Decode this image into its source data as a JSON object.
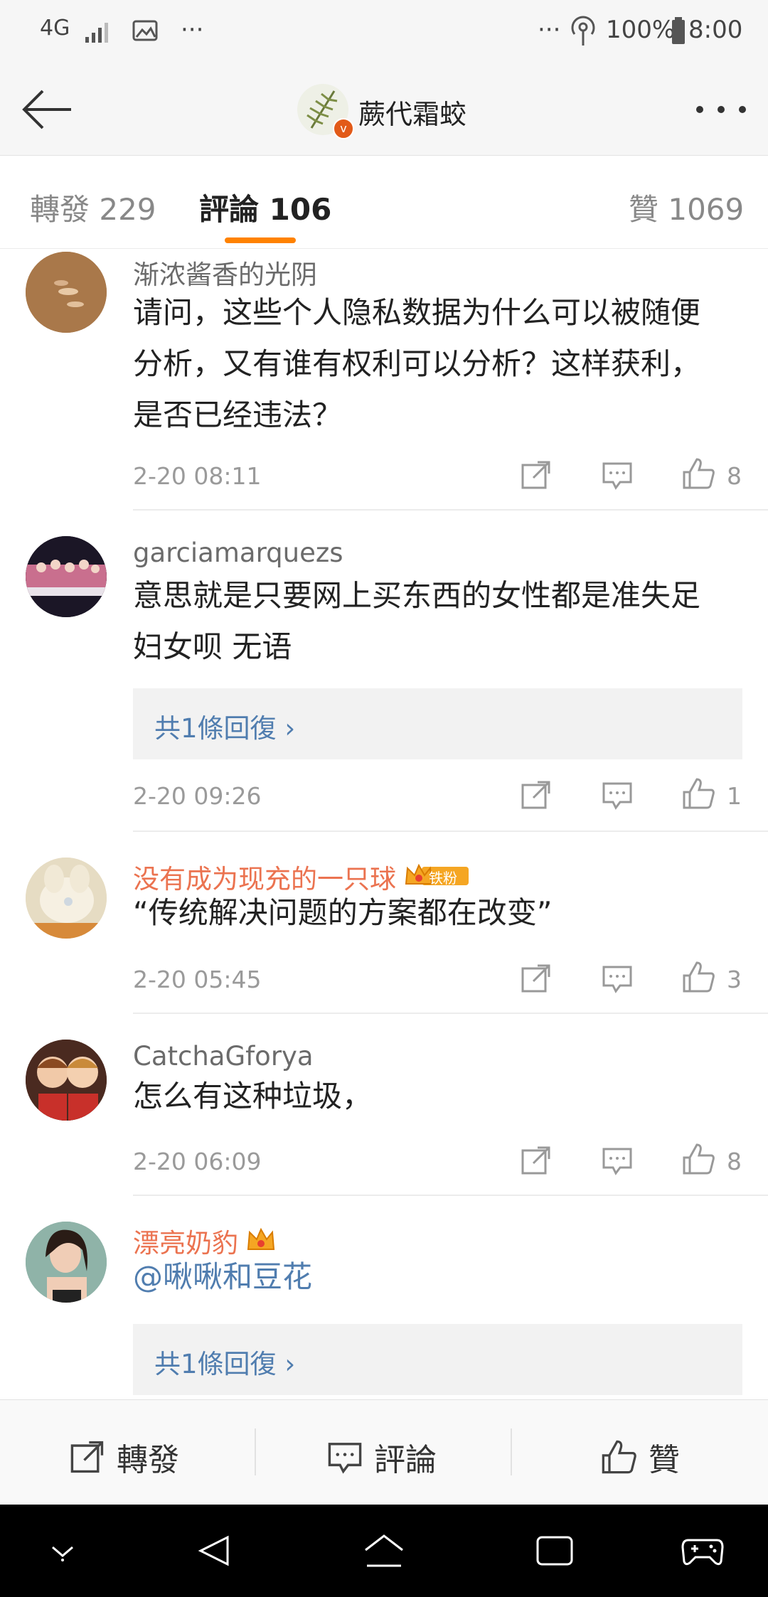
{
  "status_bar": {
    "network": "4G",
    "more_left": "···",
    "more_right": "···",
    "battery": "100%",
    "time": "8:00"
  },
  "header": {
    "title": "蕨代霜蛟"
  },
  "tabs": [
    {
      "label": "轉發 229"
    },
    {
      "label": "評論 106"
    },
    {
      "label": "贊 1069"
    }
  ],
  "comments": [
    {
      "name": "渐浓酱香的光阴",
      "text_lines": [
        "请问，这些个人隐私数据为什么可以被随便",
        "分析，又有谁有权利可以分析？这样获利，",
        "是否已经违法？"
      ],
      "time": "2-20 08:11",
      "likes": "8"
    },
    {
      "name": "garciamarquezs",
      "text_lines": [
        "意思就是只要网上买东西的女性都是准失足",
        "妇女呗 无语"
      ],
      "reply": "共1條回復",
      "time": "2-20 09:26",
      "likes": "1"
    },
    {
      "name": "没有成为现充的一只球",
      "badge": "铁粉",
      "text_lines": [
        "“传统解决问题的方案都在改变”"
      ],
      "time": "2-20 05:45",
      "likes": "3"
    },
    {
      "name": "CatchaGforya",
      "text_lines": [
        "怎么有这种垃圾，"
      ],
      "time": "2-20 06:09",
      "likes": "8"
    },
    {
      "name": "漂亮奶豹",
      "mention": "@啾啾和豆花",
      "reply": "共1條回復"
    }
  ],
  "bottom_bar": {
    "repost": "轉發",
    "comment": "評論",
    "like": "贊"
  },
  "colors": {
    "accent": "#ff8200",
    "link": "#507daf",
    "vip_name": "#eb7350"
  }
}
